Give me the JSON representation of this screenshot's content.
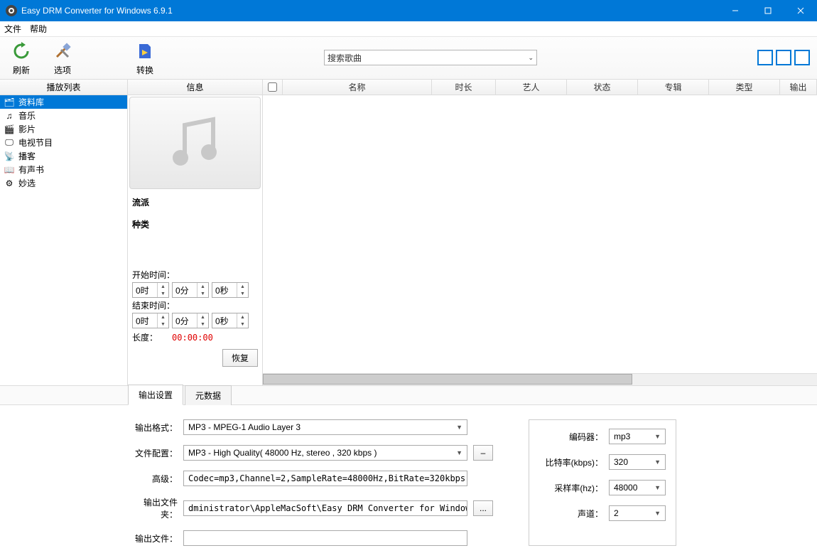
{
  "window": {
    "title": "Easy DRM Converter for Windows 6.9.1"
  },
  "menu": {
    "file": "文件",
    "help": "帮助"
  },
  "toolbar": {
    "refresh": "刷新",
    "options": "选项",
    "convert": "转换"
  },
  "search": {
    "placeholder": "搜索歌曲"
  },
  "sidebar": {
    "header": "播放列表",
    "items": [
      {
        "label": "资料库"
      },
      {
        "label": "音乐"
      },
      {
        "label": "影片"
      },
      {
        "label": "电视节目"
      },
      {
        "label": "播客"
      },
      {
        "label": "有声书"
      },
      {
        "label": "妙选"
      }
    ]
  },
  "info": {
    "header": "信息",
    "genre_label": "流派",
    "kind_label": "种类",
    "start_label": "开始时间：",
    "end_label": "结束时间：",
    "start": {
      "h": "0时",
      "m": "0分",
      "s": "0秒"
    },
    "end": {
      "h": "0时",
      "m": "0分",
      "s": "0秒"
    },
    "length_label": "长度：",
    "length_value": "00:00:00",
    "restore": "恢复"
  },
  "table": {
    "cols": [
      "名称",
      "时长",
      "艺人",
      "状态",
      "专辑",
      "类型",
      "输出"
    ]
  },
  "tabs": {
    "output": "输出设置",
    "meta": "元数据"
  },
  "settings": {
    "format_label": "输出格式：",
    "format_value": "MP3 - MPEG-1 Audio Layer 3",
    "profile_label": "文件配置：",
    "profile_value": "MP3 - High Quality( 48000 Hz, stereo , 320 kbps  )",
    "advanced_label": "高级：",
    "advanced_value": "Codec=mp3,Channel=2,SampleRate=48000Hz,BitRate=320kbps",
    "folder_label": "输出文件夹：",
    "folder_value": "dministrator\\AppleMacSoft\\Easy DRM Converter for Windows\\Converted",
    "file_label": "输出文件：",
    "file_value": "",
    "minus": "–",
    "browse": "..."
  },
  "encoder": {
    "encoder_label": "编码器：",
    "encoder_value": "mp3",
    "bitrate_label": "比特率(kbps)：",
    "bitrate_value": "320",
    "samplerate_label": "采样率(hz)：",
    "samplerate_value": "48000",
    "channels_label": "声道：",
    "channels_value": "2"
  }
}
